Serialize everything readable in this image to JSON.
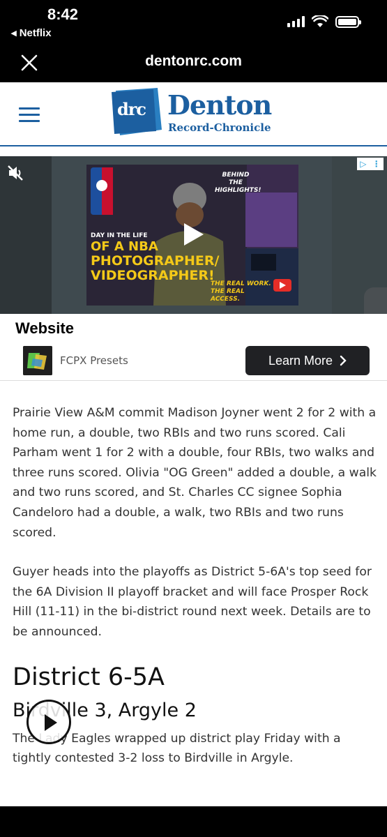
{
  "status_bar": {
    "time": "8:42",
    "back_app": "◂ Netflix"
  },
  "browser": {
    "url": "dentonrc.com"
  },
  "site": {
    "logo_mark": "drc",
    "logo_name": "Denton",
    "logo_sub": "Record-Chronicle",
    "brand_color": "#1c5fa0"
  },
  "ad": {
    "thumbnail_text": {
      "line1": "DAY IN THE LIFE",
      "line2": "OF A NBA",
      "line3": "PHOTOGRAPHER/",
      "line4": "VIDEOGRAPHER!",
      "behind": "BEHIND THE HIGHLIGHTS!",
      "real": "THE REAL WORK. THE REAL ACCESS."
    },
    "title": "Website",
    "advertiser": "FCPX Presets",
    "cta": "Learn More"
  },
  "article": {
    "paragraph1": "Prairie View A&M commit Madison Joyner went 2 for 2 with a home run, a double, two RBIs and two runs scored. Cali Parham went 1 for 2 with a double, four RBIs, two walks and three runs scored. Olivia \"OG Green\" added a double, a walk and two runs scored, and St. Charles CC signee Sophia Candeloro had a double, a walk, two RBIs and two runs scored.",
    "paragraph2": "Guyer heads into the playoffs as District 5-6A's top seed for the 6A Division II playoff bracket and will face Prosper Rock Hill (11-11) in the bi-district round next week. Details are to be announced.",
    "heading": "District 6-5A",
    "subheading": "Birdville 3, Argyle 2",
    "paragraph3": "The Lady Eagles wrapped up district play Friday with a tightly contested 3-2 loss to Birdville in Argyle."
  }
}
